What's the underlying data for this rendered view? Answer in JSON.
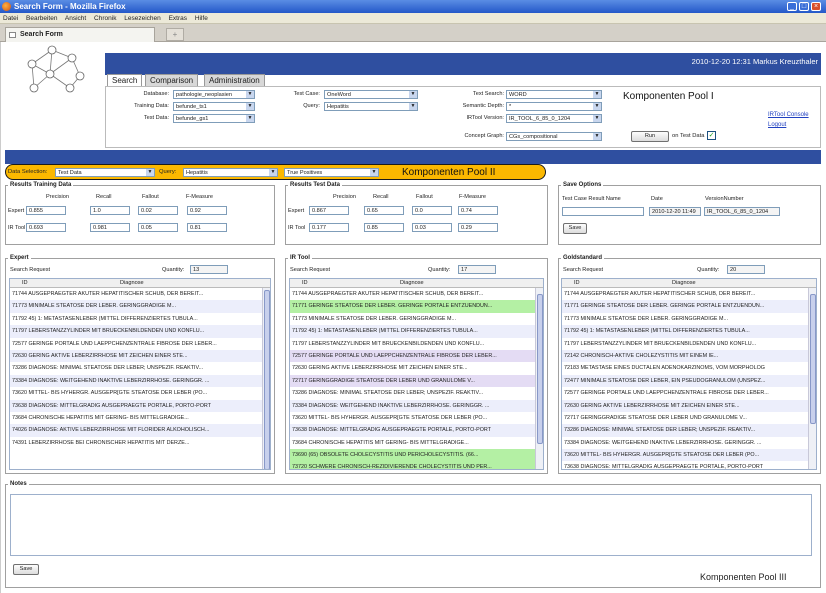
{
  "window": {
    "title": "Search Form - Mozilla Firefox"
  },
  "menu": [
    "Datei",
    "Bearbeiten",
    "Ansicht",
    "Chronik",
    "Lesezeichen",
    "Extras",
    "Hilfe"
  ],
  "browser_tab": {
    "label": "Search Form",
    "new_tab": "+"
  },
  "header": {
    "datetime_user": "2010-12-20 12:31 Markus Kreuzthaler"
  },
  "nav_tabs": [
    "Search",
    "Comparison",
    "Administration"
  ],
  "config": {
    "database_label": "Database:",
    "database_value": "pathologie_neoplasien",
    "training_label": "Training Data:",
    "training_value": "befunde_ts1",
    "testdata_label": "Test Data:",
    "testdata_value": "befunde_gs1",
    "testcase_label": "Test Case:",
    "testcase_value": "OneWord",
    "query_label": "Query:",
    "query_value": "Hepatitis",
    "textsearch_label": "Text Search:",
    "textsearch_value": "WORD",
    "semdepth_label": "Semantic Depth:",
    "semdepth_value": "*",
    "irversion_label": "IRTool Version:",
    "irversion_value": "IR_TOOL_6_85_0_1204",
    "concept_label": "Concept Graph:",
    "concept_value": "CGs_compositional",
    "pool_title": "Komponenten Pool I",
    "run_label": "Run",
    "on_test_data": "on Test Data",
    "console_link": "IRTool Console",
    "logout_link": "Logout"
  },
  "filter_bar": {
    "ds_label": "Data Selection:",
    "ds_value": "Test Data",
    "q_label": "Query:",
    "q_value": "Hepatitis",
    "tp_value": "True Positives",
    "pool_title": "Komponenten Pool II"
  },
  "results_training": {
    "title": "Results Training Data",
    "headers": [
      "Precision",
      "Recall",
      "Fallout",
      "F-Measure"
    ],
    "rows": [
      {
        "label": "Expert",
        "values": [
          "0.855",
          "1.0",
          "0.02",
          "0.92"
        ]
      },
      {
        "label": "IR Tool",
        "values": [
          "0.693",
          "0.981",
          "0.05",
          "0.81"
        ]
      }
    ]
  },
  "results_test": {
    "title": "Results Test Data",
    "headers": [
      "Precision",
      "Recall",
      "Fallout",
      "F-Measure"
    ],
    "rows": [
      {
        "label": "Expert",
        "values": [
          "0.867",
          "0.65",
          "0.0",
          "0.74"
        ]
      },
      {
        "label": "IR Tool",
        "values": [
          "0.177",
          "0.85",
          "0.03",
          "0.29"
        ]
      }
    ]
  },
  "save_options": {
    "title": "Save Options",
    "headers": [
      "Test Case Result Name",
      "Date",
      "VersionNumber"
    ],
    "date": "2010-12-20 11:49",
    "version": "IR_TOOL_6_85_0_1204",
    "save_label": "Save"
  },
  "expert": {
    "title": "Expert",
    "search_request": "Search Request",
    "quantity_label": "Quantity:",
    "quantity": "13",
    "col_id": "ID",
    "col_diag": "Diagnose",
    "rows": [
      "71744 AUSGEPRAEGTER AKUTER HEPATITISCHER SCHUB, DER BEREIT...",
      "71773 MINIMALE STEATOSE DER LEBER. GERINGGRADIGE M...",
      "71792 45) 1: METASTASENLEBER (MITTEL DIFFERENZIERTES TUBULA...",
      "71797 LEBERSTANZZYLINDER MIT BRUECKENBILDENDEN UND KONFLU...",
      "72577 GERINGE PORTALE UND LAEPPCHENZENTRALE FIBROSE DER LEBER...",
      "72630 GERING AKTIVE LEBERZIRRHOSE MIT ZEICHEN EINER STE...",
      "73286 DIAGNOSE: MINIMAL STEATOSE DER LEBER; UNSPEZIF. REAKTIV...",
      "73384 DIAGNOSE: WEITGEHEND INAKTIVE LEBERZIRRHOSE. GERINGGR. ...",
      "73620 MITTEL- BIS HYHERGR. AUSGEPR[GTE STEATOSE DER LEBER (PO...",
      "73638 DIAGNOSE: MITTELGRADIG AUSGEPRAEGTE PORTALE, PORTO-PORT",
      "73684 CHRONISCHE HEPATITIS MIT GERING- BIS MITTELGRADIGE...",
      "74026 DIAGNOSE: AKTIVE LEBERZIRRHOSE MIT FLORIDER ALKOHOLISCH...",
      "74391 LEBERZIRRHOSE BEI CHRONISCHER HEPATITIS MIT DERZE..."
    ]
  },
  "irtool": {
    "title": "IR Tool",
    "search_request": "Search Request",
    "quantity_label": "Quantity:",
    "quantity": "17",
    "col_id": "ID",
    "col_diag": "Diagnose",
    "rows": [
      "71744 AUSGEPRAEGTER AKUTER HEPATITISCHER SCHUB, DER BEREIT...",
      "71771 GERINGE STEATOSE DER LEBER. GERINGE PORTALE ENTZUENDUN...",
      "71773 MINIMALE STEATOSE DER LEBER. GERINGGRADIGE M...",
      "71792 45) 1: METASTASENLEBER (MITTEL DIFFERENZIERTES TUBULA...",
      "71797 LEBERSTANZZYLINDER MIT BRUECKENBILDENDEN UND KONFLU...",
      "72577 GERINGE PORTALE UND LAEPPCHENZENTRALE FIBROSE DER LEBER...",
      "72630 GERING AKTIVE LEBERZIRRHOSE MIT ZEICHEN EINER STE...",
      "72717 GERINGGRADIGE STEATOSE DER LEBER UND GRANULOME V...",
      "73286 DIAGNOSE: MINIMAL STEATOSE DER LEBER; UNSPEZIF. REAKTIV...",
      "73384 DIAGNOSE: WEITGEHEND INAKTIVE LEBERZIRRHOSE. GERINGGR. ...",
      "73620 MITTEL- BIS HYHERGR. AUSGEPR[GTE STEATOSE DER LEBER (PO...",
      "73638 DIAGNOSE: MITTELGRADIG AUSGEPRAEGTE PORTALE, PORTO-PORT",
      "73684 CHRONISCHE HEPATITIS MIT GERING- BIS MITTELGRADIGE...",
      "73690 (65) OBSOLETE CHOLECYSTITIS UND PERICHOLECYSTITIS. (66...",
      "73720 SCHWERE CHRONISCH-REZIDIVIERENDE CHOLECYSTITIS UND PER...",
      "74026 DIAGNOSE: AKTIVE LEBERZIRRHOSE MIT FLORIDER ALKOHOLISCH..."
    ],
    "row_styles": [
      "",
      "g",
      "",
      "",
      "",
      "p",
      "",
      "p",
      "",
      "",
      "",
      "",
      "",
      "g",
      "g",
      ""
    ]
  },
  "goldstandard": {
    "title": "Goldstandard",
    "search_request": "Search Request",
    "quantity_label": "Quantity:",
    "quantity": "20",
    "col_id": "ID",
    "col_diag": "Diagnose",
    "rows": [
      "71744 AUSGEPRAEGTER AKUTER HEPATITISCHER SCHUB, DER BEREIT...",
      "71771 GERINGE STEATOSE DER LEBER. GERINGE PORTALE ENTZUENDUN...",
      "71773 MINIMALE STEATOSE DER LEBER. GERINGGRADIGE M...",
      "71792 45) 1: METASTASENLEBER (MITTEL DIFFERENZIERTES TUBULA...",
      "71797 LEBERSTANZZYLINDER MIT BRUECKENBILDENDEN UND KONFLU...",
      "72142 CHRONISCH-AKTIVE CHOLEZYSTITIS MIT EINEM IE...",
      "72183 METASTASE EINES DUCTALEN ADENOKARZINOMS, VOM MORPHOLOG",
      "72477 MINIMALE STEATOSE DER LEBER, EIN PSEUDOGRANULOM (UNSPEZ...",
      "72577 GERINGE PORTALE UND LAEPPCHENZENTRALE FIBROSE DER LEBER...",
      "72630 GERING AKTIVE LEBERZIRRHOSE MIT ZEICHEN EINER STE...",
      "72717 GERINGGRADIGE STEATOSE DER LEBER UND GRANULOME V...",
      "73286 DIAGNOSE: MINIMAL STEATOSE DER LEBER; UNSPEZIF. REAKTIV...",
      "73384 DIAGNOSE: WEITGEHEND INAKTIVE LEBERZIRRHOSE. GERINGGR. ...",
      "73620 MITTEL- BIS HYHERGR. AUSGEPR[GTE STEATOSE DER LEBER (PO...",
      "73638 DIAGNOSE: MITTELGRADIG AUSGEPRAEGTE PORTALE, PORTO-PORT",
      "73684 CHRONISCHE HEPATITIS MIT GERING- BIS MITTELGRADIGE..."
    ]
  },
  "notes": {
    "title": "Notes",
    "save_label": "Save",
    "pool_title": "Komponenten Pool III"
  }
}
